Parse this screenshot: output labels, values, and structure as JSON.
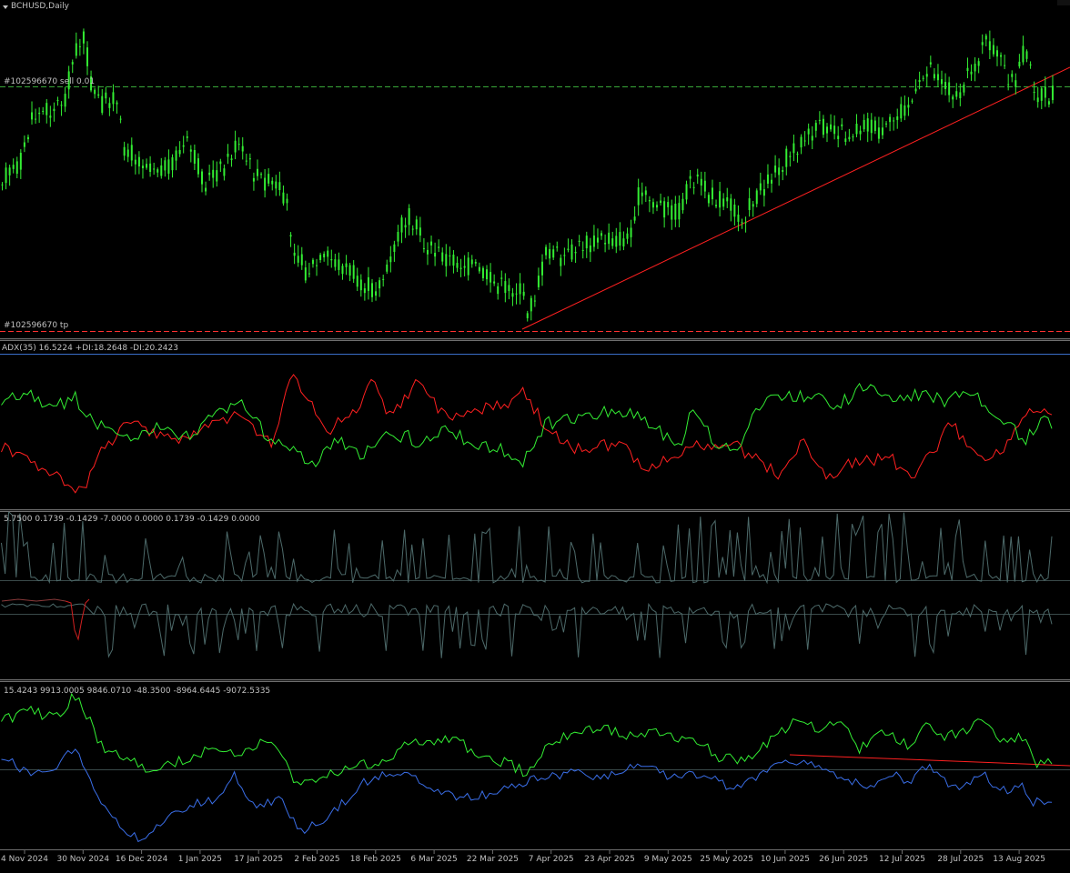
{
  "window": {
    "title": "BCHUSD,Daily"
  },
  "main_chart": {
    "sell_label": "#102596670 sell 0.01",
    "tp_label": "#102596670 tp",
    "candle_color": "#33ee33",
    "trend_line_color": "#ff2020"
  },
  "adx": {
    "label": "ADX(35) 16.5224 +DI:18.2648 -DI:20.2423",
    "plus_di_color": "#33ee33",
    "minus_di_color": "#ff2020",
    "adx_color": "#3a6ec8"
  },
  "osc": {
    "label": "5.7500 0.1739 -0.1429 -7.0000 0.0000 0.1739 -0.1429 0.0000"
  },
  "obv": {
    "label": "15.4243 9913.0005 9846.0710 -48.3500 -8964.6445 -9072.5335"
  },
  "x_axis": {
    "ticks": [
      "4 Nov 2024",
      "30 Nov 2024",
      "16 Dec 2024",
      "1 Jan 2025",
      "17 Jan 2025",
      "2 Feb 2025",
      "18 Feb 2025",
      "6 Mar 2025",
      "22 Mar 2025",
      "7 Apr 2025",
      "23 Apr 2025",
      "9 May 2025",
      "25 May 2025",
      "10 Jun 2025",
      "26 Jun 2025",
      "12 Jul 2025",
      "28 Jul 2025",
      "13 Aug 2025"
    ]
  }
}
